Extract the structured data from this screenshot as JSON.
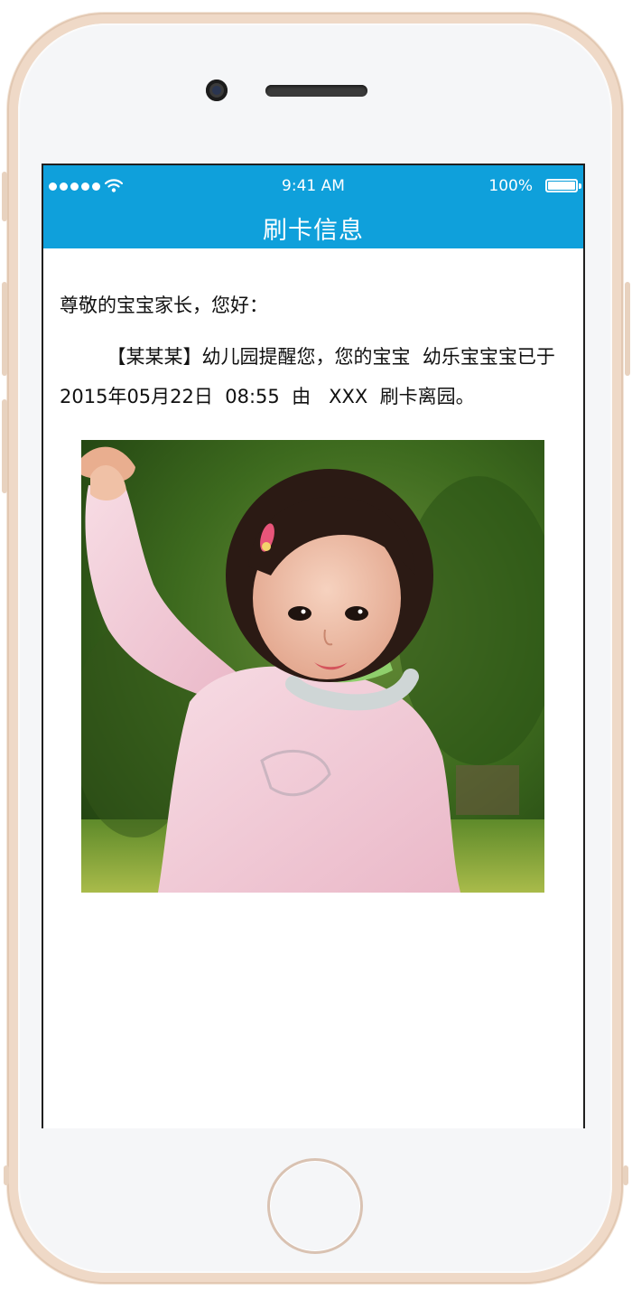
{
  "status_bar": {
    "time": "9:41 AM",
    "battery": "100%",
    "signal_icon": "signal-dots-icon",
    "wifi_icon": "wifi-icon",
    "battery_icon": "battery-icon",
    "battery_level": 1.0
  },
  "nav": {
    "title": "刷卡信息"
  },
  "notice": {
    "greeting": "尊敬的宝宝家长，您好：",
    "message": "【某某某】幼儿园提醒您，您的宝宝  幼乐宝宝宝已于2015年05月22日  08:55  由   XXX  刷卡离园。"
  },
  "photo": {
    "alt": "孩子照片"
  },
  "colors": {
    "header": "#0fa0db",
    "text": "#111111",
    "frame": "#efd9c7"
  }
}
